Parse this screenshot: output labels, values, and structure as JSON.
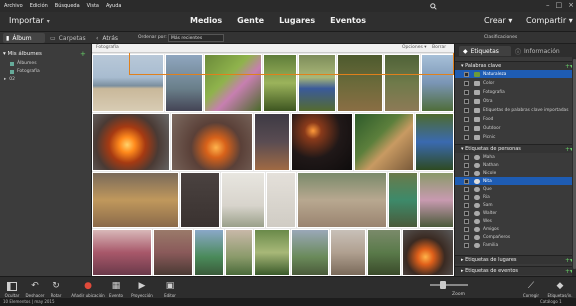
{
  "menu": [
    "Archivo",
    "Edición",
    "Búsqueda",
    "Vista",
    "Ayuda"
  ],
  "topbar": {
    "import": "Importar",
    "nav": [
      "Medios",
      "Gente",
      "Lugares",
      "Eventos"
    ],
    "create": "Crear",
    "share": "Compartir"
  },
  "subbar": {
    "album_tab": "Álbum",
    "folders_tab": "Carpetas",
    "back": "Atrás",
    "sort_label": "Ordenar por:",
    "sort_value": "Más recientes",
    "classification": "Clasificaciones"
  },
  "left": {
    "header": "Mis álbumes",
    "items": [
      "Álbumes",
      "Fotografía",
      "02"
    ]
  },
  "grid": {
    "breadcrumb": "Fotografía",
    "options": "Opciones ▾",
    "clear": "Borrar"
  },
  "right": {
    "tab_tags": "Etiquetas",
    "tab_info": "Información",
    "keywords_header": "Palabras clave",
    "keywords": [
      "Naturaleza",
      "Color",
      "Fotografía",
      "Otra",
      "Etiquetas de palabras clave importadas",
      "Food",
      "Outdoor",
      "Picnic"
    ],
    "people_header": "Etiquetas de personas",
    "people": [
      "Maha",
      "Nathan",
      "Nicole",
      "Nita",
      "Que",
      "Ria",
      "Sam",
      "Walter",
      "Wes",
      "Amigos",
      "Compañeros",
      "Familia"
    ],
    "selected_person": "Nita",
    "places_header": "Etiquetas de lugares",
    "events_header": "Etiquetas de eventos"
  },
  "toolbar": {
    "items": [
      "Ocultar",
      "Deshacer",
      "Rotar",
      "Añadir ubicación",
      "Evento",
      "Proyección",
      "Editor"
    ],
    "zoom": "Zoom",
    "right_items": [
      "Corregir",
      "Etiquetas/in."
    ]
  },
  "status": {
    "left": "10 Elementos  |  may 2015",
    "right": "Catálogo 1"
  },
  "colors": {
    "accent_blue": "#1e5cb3",
    "selection_orange": "#e0801c",
    "plus_green": "#66cc66"
  }
}
